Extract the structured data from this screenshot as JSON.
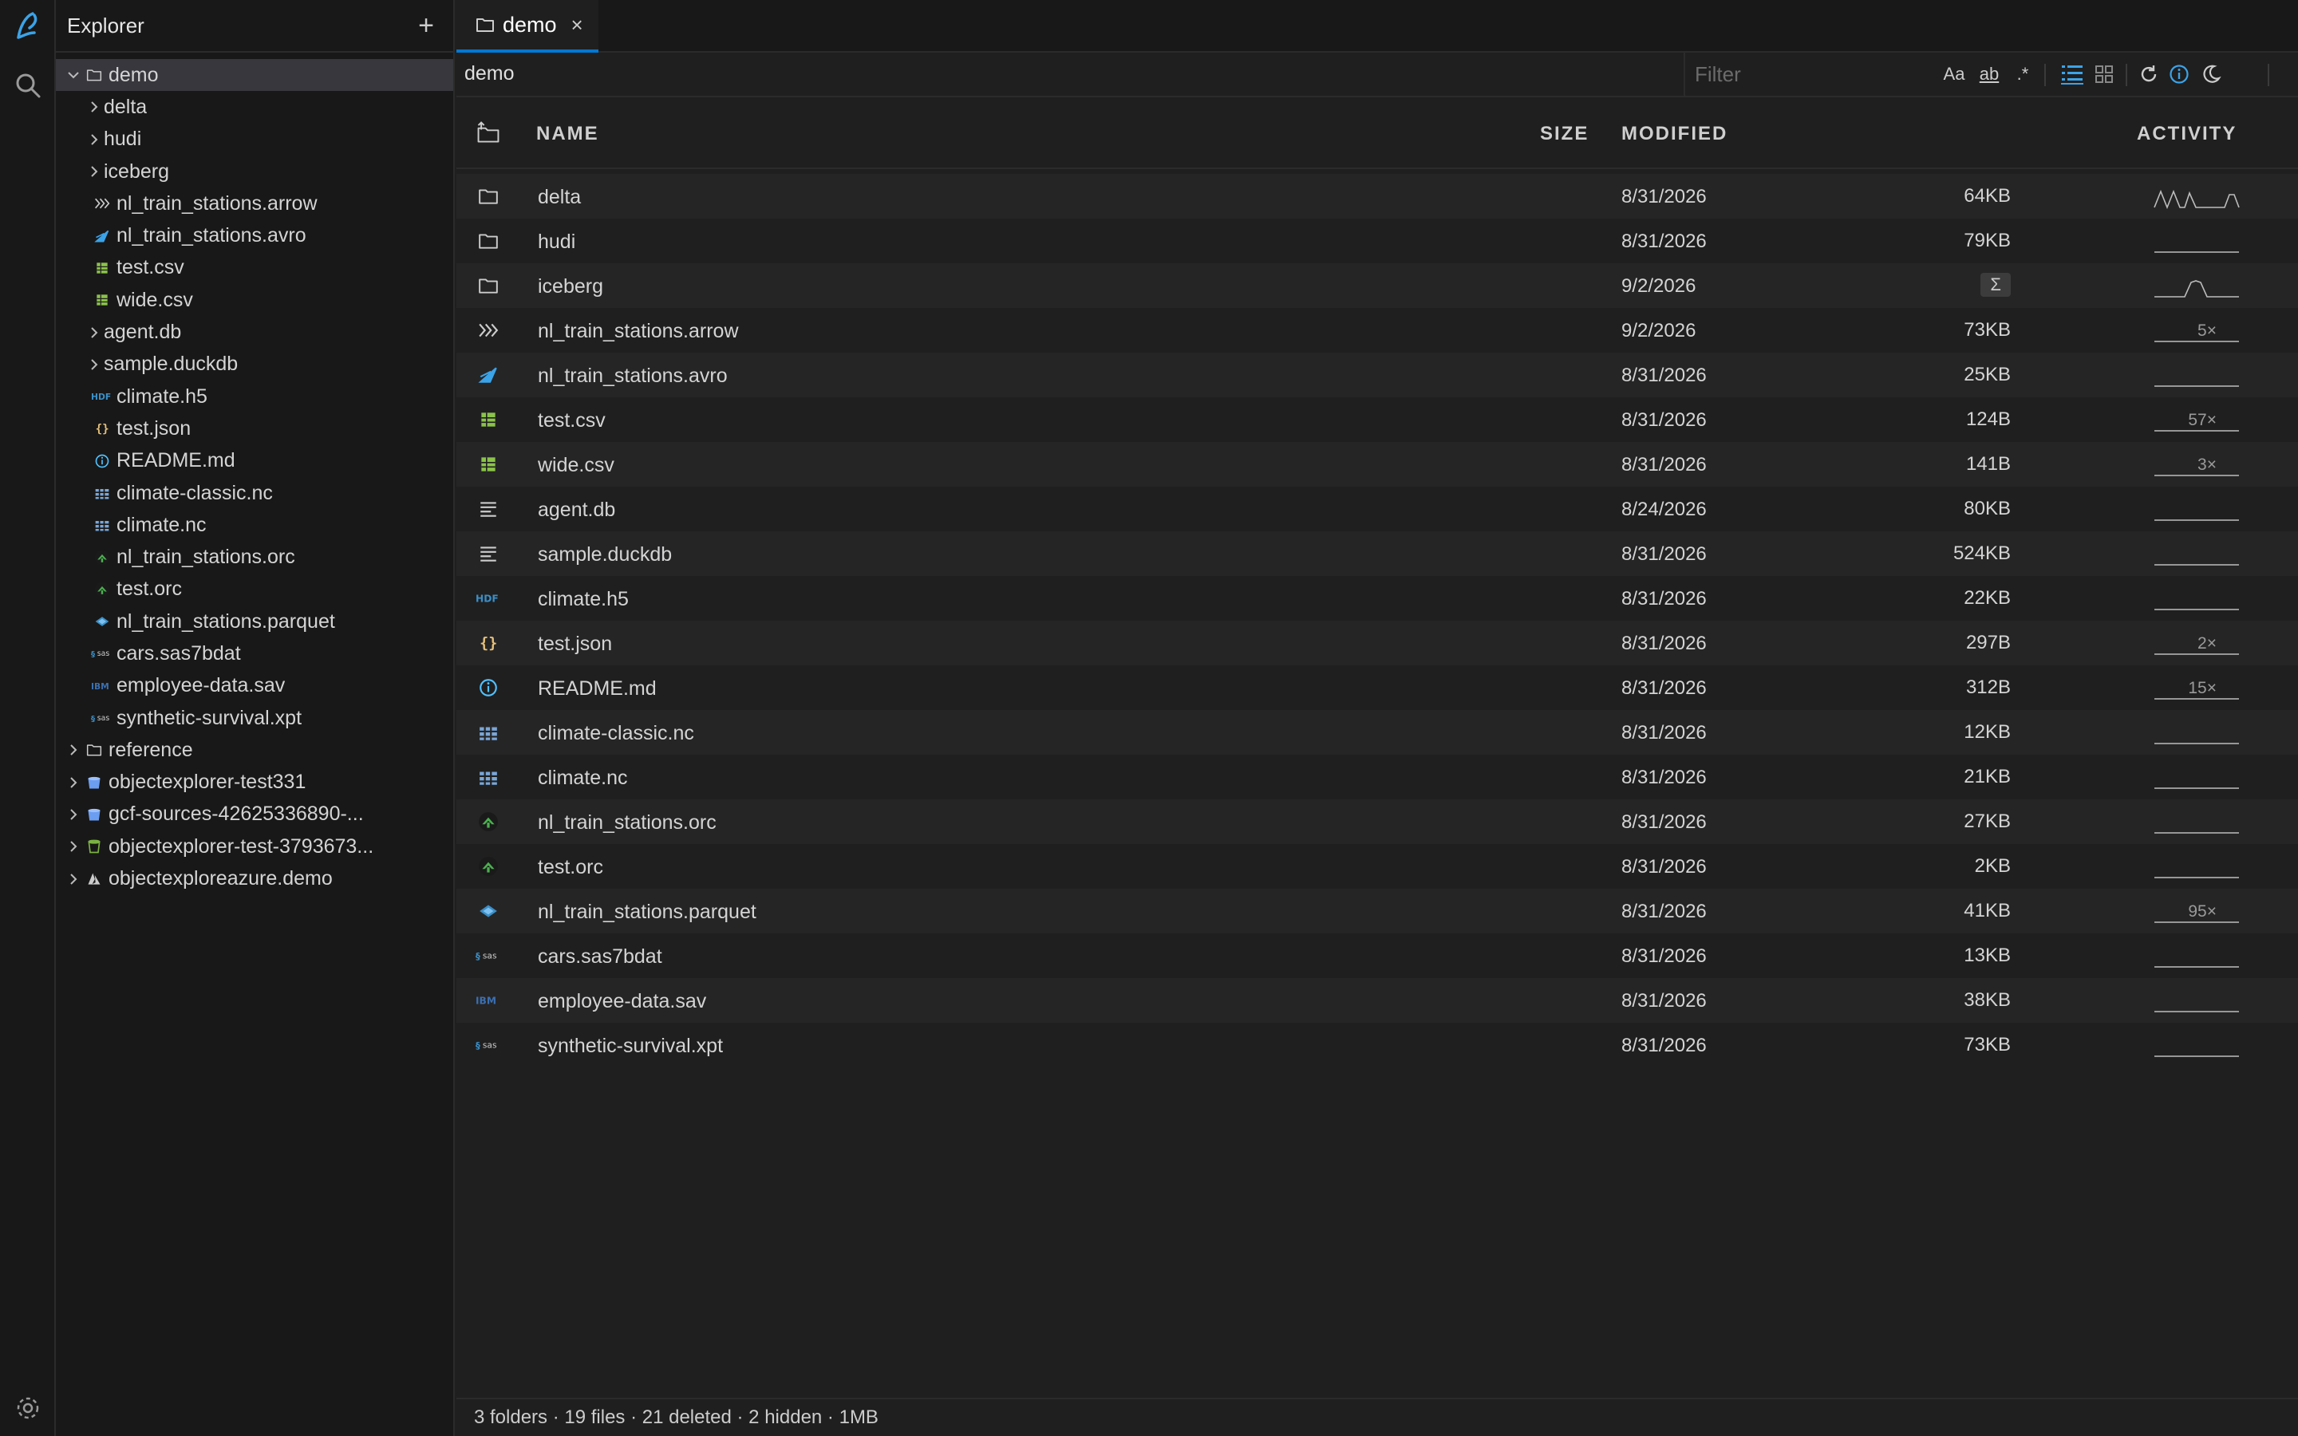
{
  "sidebar": {
    "title": "Explorer",
    "add_label": "+",
    "items": [
      {
        "label": "demo",
        "depth": 0,
        "chevron": "down",
        "icon": "folder-icon",
        "selected": true
      },
      {
        "label": "delta",
        "depth": 1,
        "chevron": "right",
        "icon": ""
      },
      {
        "label": "hudi",
        "depth": 1,
        "chevron": "right",
        "icon": ""
      },
      {
        "label": "iceberg",
        "depth": 1,
        "chevron": "right",
        "icon": ""
      },
      {
        "label": "nl_train_stations.arrow",
        "depth": 1,
        "chevron": "",
        "icon": "arrow-file-icon"
      },
      {
        "label": "nl_train_stations.avro",
        "depth": 1,
        "chevron": "",
        "icon": "avro-file-icon"
      },
      {
        "label": "test.csv",
        "depth": 1,
        "chevron": "",
        "icon": "csv-file-icon"
      },
      {
        "label": "wide.csv",
        "depth": 1,
        "chevron": "",
        "icon": "csv-file-icon"
      },
      {
        "label": "agent.db",
        "depth": 1,
        "chevron": "right",
        "icon": ""
      },
      {
        "label": "sample.duckdb",
        "depth": 1,
        "chevron": "right",
        "icon": ""
      },
      {
        "label": "climate.h5",
        "depth": 1,
        "chevron": "",
        "icon": "hdf-file-icon"
      },
      {
        "label": "test.json",
        "depth": 1,
        "chevron": "",
        "icon": "json-file-icon"
      },
      {
        "label": "README.md",
        "depth": 1,
        "chevron": "",
        "icon": "info-file-icon"
      },
      {
        "label": "climate-classic.nc",
        "depth": 1,
        "chevron": "",
        "icon": "netcdf-file-icon"
      },
      {
        "label": "climate.nc",
        "depth": 1,
        "chevron": "",
        "icon": "netcdf-file-icon"
      },
      {
        "label": "nl_train_stations.orc",
        "depth": 1,
        "chevron": "",
        "icon": "orc-file-icon"
      },
      {
        "label": "test.orc",
        "depth": 1,
        "chevron": "",
        "icon": "orc-file-icon"
      },
      {
        "label": "nl_train_stations.parquet",
        "depth": 1,
        "chevron": "",
        "icon": "parquet-file-icon"
      },
      {
        "label": "cars.sas7bdat",
        "depth": 1,
        "chevron": "",
        "icon": "sas-file-icon"
      },
      {
        "label": "employee-data.sav",
        "depth": 1,
        "chevron": "",
        "icon": "spss-file-icon"
      },
      {
        "label": "synthetic-survival.xpt",
        "depth": 1,
        "chevron": "",
        "icon": "sas-file-icon"
      },
      {
        "label": "reference",
        "depth": 0,
        "chevron": "right",
        "icon": "folder-icon"
      },
      {
        "label": "objectexplorer-test331",
        "depth": 0,
        "chevron": "right",
        "icon": "bucket-icon"
      },
      {
        "label": "gcf-sources-42625336890-...",
        "depth": 0,
        "chevron": "right",
        "icon": "bucket-icon"
      },
      {
        "label": "objectexplorer-test-3793673...",
        "depth": 0,
        "chevron": "right",
        "icon": "s3-bucket-icon"
      },
      {
        "label": "objectexploreazure.demo",
        "depth": 0,
        "chevron": "right",
        "icon": "azure-icon"
      }
    ]
  },
  "tab": {
    "label": "demo",
    "close": "×"
  },
  "breadcrumb": "demo",
  "filter": {
    "placeholder": "Filter"
  },
  "toolbar": {
    "match_case": "Aa",
    "whole_word": "ab",
    "regex": ".*"
  },
  "table": {
    "headers": {
      "name": "NAME",
      "size": "SIZE",
      "modified": "MODIFIED",
      "activity": "ACTIVITY"
    },
    "rows": [
      {
        "name": "delta",
        "size": "64KB",
        "modified": "8/31/2026",
        "count": "",
        "icon": "folder-icon",
        "spark": "waves"
      },
      {
        "name": "hudi",
        "size": "79KB",
        "modified": "8/31/2026",
        "count": "",
        "icon": "folder-icon",
        "spark": "flat"
      },
      {
        "name": "iceberg",
        "size": "Σ",
        "modified": "9/2/2026",
        "count": "",
        "icon": "folder-icon",
        "spark": "bump",
        "badge": true
      },
      {
        "name": "nl_train_stations.arrow",
        "size": "73KB",
        "modified": "9/2/2026",
        "count": "5×",
        "icon": "arrow-file-icon",
        "spark": "flat"
      },
      {
        "name": "nl_train_stations.avro",
        "size": "25KB",
        "modified": "8/31/2026",
        "count": "",
        "icon": "avro-file-icon",
        "spark": "flat"
      },
      {
        "name": "test.csv",
        "size": "124B",
        "modified": "8/31/2026",
        "count": "57×",
        "icon": "csv-file-icon",
        "spark": "flat"
      },
      {
        "name": "wide.csv",
        "size": "141B",
        "modified": "8/31/2026",
        "count": "3×",
        "icon": "csv-file-icon",
        "spark": "flat"
      },
      {
        "name": "agent.db",
        "size": "80KB",
        "modified": "8/24/2026",
        "count": "",
        "icon": "database-icon",
        "spark": "flat"
      },
      {
        "name": "sample.duckdb",
        "size": "524KB",
        "modified": "8/31/2026",
        "count": "",
        "icon": "database-icon",
        "spark": "flat"
      },
      {
        "name": "climate.h5",
        "size": "22KB",
        "modified": "8/31/2026",
        "count": "",
        "icon": "hdf-file-icon",
        "spark": "flat"
      },
      {
        "name": "test.json",
        "size": "297B",
        "modified": "8/31/2026",
        "count": "2×",
        "icon": "json-file-icon",
        "spark": "flat"
      },
      {
        "name": "README.md",
        "size": "312B",
        "modified": "8/31/2026",
        "count": "15×",
        "icon": "info-file-icon",
        "spark": "flat"
      },
      {
        "name": "climate-classic.nc",
        "size": "12KB",
        "modified": "8/31/2026",
        "count": "",
        "icon": "netcdf-file-icon",
        "spark": "flat"
      },
      {
        "name": "climate.nc",
        "size": "21KB",
        "modified": "8/31/2026",
        "count": "",
        "icon": "netcdf-file-icon",
        "spark": "flat"
      },
      {
        "name": "nl_train_stations.orc",
        "size": "27KB",
        "modified": "8/31/2026",
        "count": "",
        "icon": "orc-file-icon",
        "spark": "flat"
      },
      {
        "name": "test.orc",
        "size": "2KB",
        "modified": "8/31/2026",
        "count": "",
        "icon": "orc-file-icon",
        "spark": "flat"
      },
      {
        "name": "nl_train_stations.parquet",
        "size": "41KB",
        "modified": "8/31/2026",
        "count": "95×",
        "icon": "parquet-file-icon",
        "spark": "flat"
      },
      {
        "name": "cars.sas7bdat",
        "size": "13KB",
        "modified": "8/31/2026",
        "count": "",
        "icon": "sas-file-icon",
        "spark": "flat"
      },
      {
        "name": "employee-data.sav",
        "size": "38KB",
        "modified": "8/31/2026",
        "count": "",
        "icon": "spss-file-icon",
        "spark": "flat"
      },
      {
        "name": "synthetic-survival.xpt",
        "size": "73KB",
        "modified": "8/31/2026",
        "count": "",
        "icon": "sas-file-icon",
        "spark": "flat"
      }
    ]
  },
  "status": "3 folders · 19 files · 21 deleted · 2 hidden · 1MB",
  "colors": {
    "accent": "#0078d4",
    "csv": "#8bc34a",
    "orc": "#4caf50",
    "json": "#e5c07b",
    "info": "#4fc1ff",
    "avro": "#3ba3e8"
  }
}
